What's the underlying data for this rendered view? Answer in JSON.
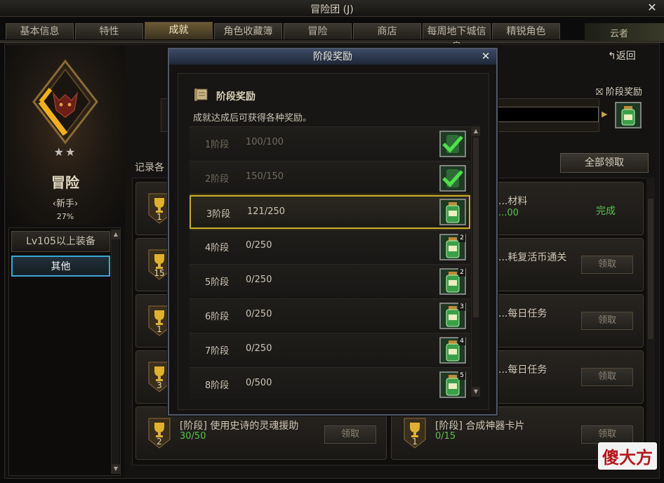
{
  "window": {
    "title": "冒险团 (J)"
  },
  "tabs": [
    {
      "label": "基本信息",
      "active": false
    },
    {
      "label": "特性",
      "active": false
    },
    {
      "label": "成就",
      "active": true
    },
    {
      "label": "角色收藏簿",
      "active": false
    },
    {
      "label": "冒险",
      "active": false
    },
    {
      "label": "商店",
      "active": false
    },
    {
      "label": "每周地下城信息",
      "active": false
    },
    {
      "label": "精锐角色",
      "active": false
    }
  ],
  "top_right_deco": "云者",
  "left_panel": {
    "stars": "★★",
    "rank_title": "冒险",
    "rank_sub": "‹新手›",
    "rank_progress": "27%",
    "categories": [
      {
        "label": "Lv105以上装备",
        "selected": false
      },
      {
        "label": "其他",
        "selected": true
      }
    ]
  },
  "right_panel": {
    "back_label": "返回",
    "stage_reward_label": "阶段奖励",
    "record_label": "记录各",
    "claim_all_label": "全部领取",
    "achievements": [
      {
        "cup": "1",
        "name": "...材料",
        "progress": "...00",
        "status": "完成"
      },
      {
        "cup": "15",
        "name": "...耗复活币通关",
        "claim": "领取"
      },
      {
        "cup": "1",
        "name": "...每日任务",
        "claim": "领取"
      },
      {
        "cup": "3",
        "name": "...每日任务",
        "claim": "领取"
      },
      {
        "cup": "2",
        "name": "[阶段] 使用史诗的灵魂援助",
        "progress": "30/50",
        "claim": "领取"
      },
      {
        "cup": "1",
        "name": "[阶段] 合成神器卡片",
        "progress": "0/15",
        "claim": "领取"
      }
    ]
  },
  "modal": {
    "title": "阶段奖励",
    "heading": "阶段奖励",
    "description": "成就达成后可获得各种奖励。",
    "rows": [
      {
        "stage": "1阶段",
        "progress": "100/100",
        "state": "claimed",
        "count": ""
      },
      {
        "stage": "2阶段",
        "progress": "150/150",
        "state": "claimed",
        "count": ""
      },
      {
        "stage": "3阶段",
        "progress": "121/250",
        "state": "current",
        "count": ""
      },
      {
        "stage": "4阶段",
        "progress": "0/250",
        "state": "locked",
        "count": "2"
      },
      {
        "stage": "5阶段",
        "progress": "0/250",
        "state": "locked",
        "count": "2"
      },
      {
        "stage": "6阶段",
        "progress": "0/250",
        "state": "locked",
        "count": "3"
      },
      {
        "stage": "7阶段",
        "progress": "0/250",
        "state": "locked",
        "count": "4"
      },
      {
        "stage": "8阶段",
        "progress": "0/500",
        "state": "locked",
        "count": "5"
      }
    ]
  },
  "watermark": "傻大方",
  "colors": {
    "gold": "#c9a92c",
    "green": "#58c44a",
    "blue": "#3ba7d4"
  }
}
